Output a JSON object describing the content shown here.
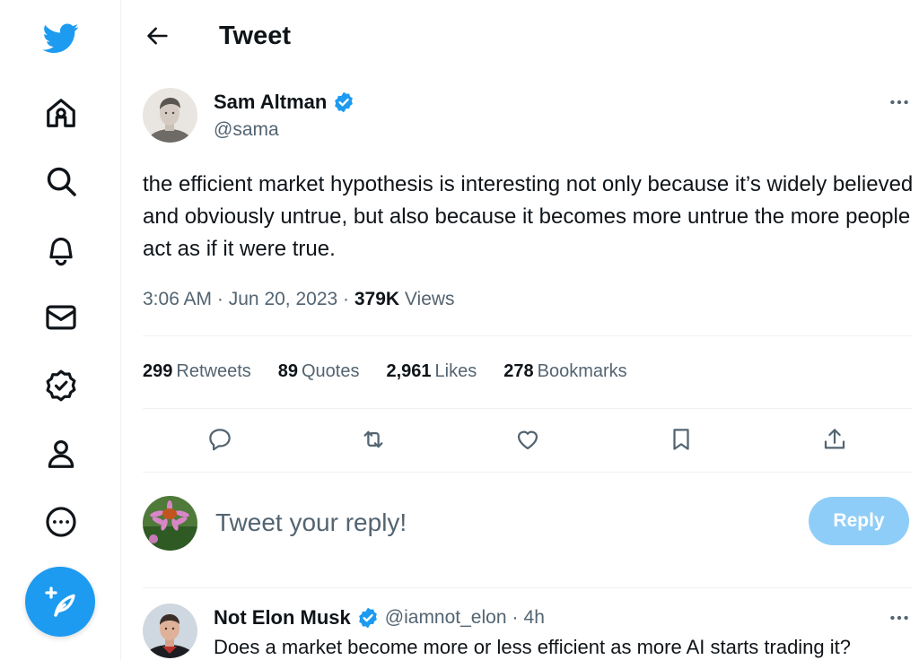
{
  "app": {
    "name": "Twitter",
    "accent": "#1d9bf0"
  },
  "sidebar": {
    "items": [
      {
        "name": "home",
        "icon": "home-icon"
      },
      {
        "name": "explore",
        "icon": "search-icon"
      },
      {
        "name": "notifications",
        "icon": "bell-icon"
      },
      {
        "name": "messages",
        "icon": "envelope-icon"
      },
      {
        "name": "verified",
        "icon": "verified-badge-icon"
      },
      {
        "name": "profile",
        "icon": "person-icon"
      },
      {
        "name": "more",
        "icon": "more-circle-icon"
      }
    ],
    "compose_icon": "compose-feather-icon"
  },
  "header": {
    "title": "Tweet",
    "back_icon": "back-arrow-icon"
  },
  "tweet": {
    "author": {
      "name": "Sam Altman",
      "handle": "@sama",
      "verified": true
    },
    "text": "the efficient market hypothesis is interesting not only because it’s widely believed and obviously untrue, but also because it becomes more untrue the more people act as if it were true.",
    "time": "3:06 AM",
    "date": "Jun 20, 2023",
    "views_count": "379K",
    "views_label": "Views",
    "separator": "·",
    "stats": [
      {
        "count": "299",
        "label": "Retweets"
      },
      {
        "count": "89",
        "label": "Quotes"
      },
      {
        "count": "2,961",
        "label": "Likes"
      },
      {
        "count": "278",
        "label": "Bookmarks"
      }
    ],
    "actions": [
      "reply-icon",
      "retweet-icon",
      "like-icon",
      "bookmark-icon",
      "share-icon"
    ]
  },
  "composer": {
    "placeholder": "Tweet your reply!",
    "button_label": "Reply",
    "button_color": "#8ecdf8"
  },
  "replies": [
    {
      "name": "Not Elon Musk",
      "handle": "@iamnot_elon",
      "separator": "·",
      "age": "4h",
      "verified": true,
      "text": "Does a market become more or less efficient as more AI starts trading it?"
    }
  ]
}
